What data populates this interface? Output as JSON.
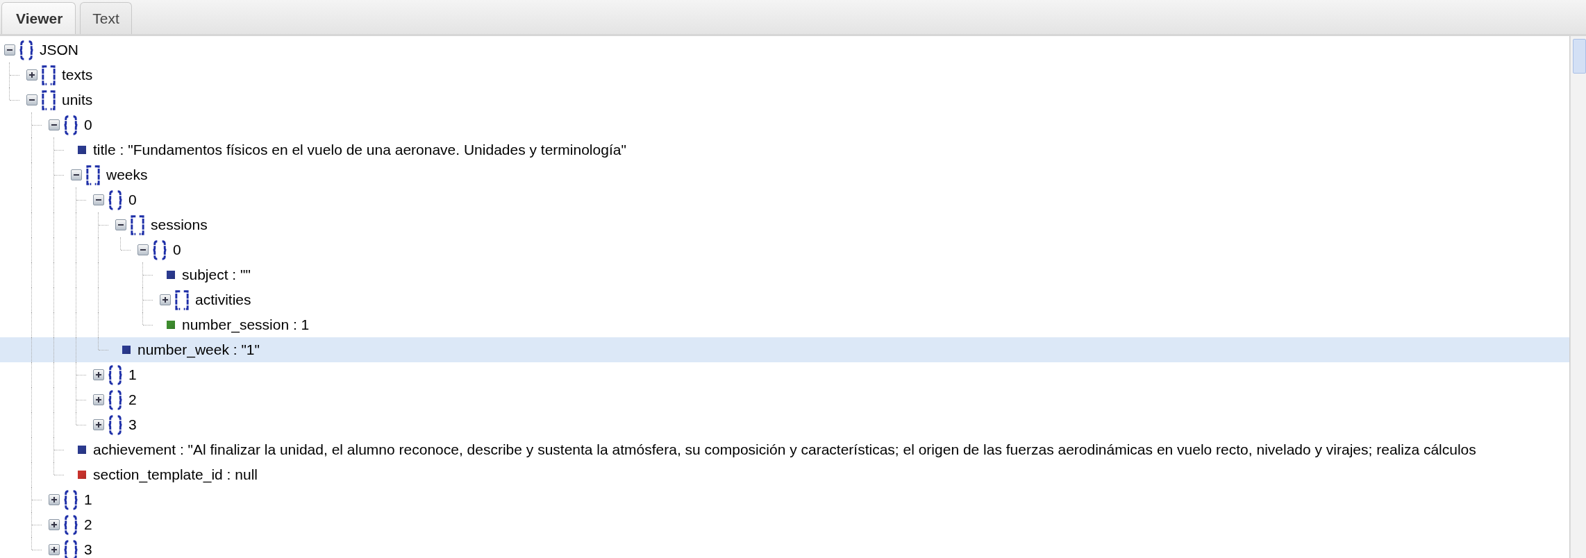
{
  "tabs": [
    {
      "label": "Viewer",
      "selected": true
    },
    {
      "label": "Text",
      "selected": false
    }
  ],
  "tree": {
    "kind": "object",
    "label": "JSON",
    "expanded": true,
    "selected": false,
    "children": [
      {
        "kind": "array",
        "label": "texts",
        "expanded": false,
        "selected": false
      },
      {
        "kind": "array",
        "label": "units",
        "expanded": true,
        "selected": false,
        "children": [
          {
            "kind": "object",
            "label": "0",
            "expanded": true,
            "selected": false,
            "children": [
              {
                "kind": "string",
                "label": "title : \"Fundamentos físicos en el vuelo de una aeronave. Unidades y terminología\"",
                "selected": false
              },
              {
                "kind": "array",
                "label": "weeks",
                "expanded": true,
                "selected": false,
                "children": [
                  {
                    "kind": "object",
                    "label": "0",
                    "expanded": true,
                    "selected": false,
                    "children": [
                      {
                        "kind": "array",
                        "label": "sessions",
                        "expanded": true,
                        "selected": false,
                        "children": [
                          {
                            "kind": "object",
                            "label": "0",
                            "expanded": true,
                            "selected": false,
                            "children": [
                              {
                                "kind": "string",
                                "label": "subject : \"\"",
                                "selected": false
                              },
                              {
                                "kind": "array",
                                "label": "activities",
                                "expanded": false,
                                "selected": false
                              },
                              {
                                "kind": "number",
                                "label": "number_session : 1",
                                "selected": false
                              }
                            ]
                          }
                        ]
                      },
                      {
                        "kind": "string",
                        "label": "number_week : \"1\"",
                        "selected": true
                      }
                    ]
                  },
                  {
                    "kind": "object",
                    "label": "1",
                    "expanded": false,
                    "selected": false
                  },
                  {
                    "kind": "object",
                    "label": "2",
                    "expanded": false,
                    "selected": false
                  },
                  {
                    "kind": "object",
                    "label": "3",
                    "expanded": false,
                    "selected": false
                  }
                ]
              },
              {
                "kind": "string",
                "label": "achievement : \"Al finalizar la unidad, el alumno reconoce, describe y sustenta la atmósfera, su composición y características; el origen de las fuerzas aerodinámicas en vuelo recto, nivelado y virajes; realiza cálculos",
                "selected": false
              },
              {
                "kind": "null",
                "label": "section_template_id : null",
                "selected": false
              }
            ]
          },
          {
            "kind": "object",
            "label": "1",
            "expanded": false,
            "selected": false
          },
          {
            "kind": "object",
            "label": "2",
            "expanded": false,
            "selected": false
          },
          {
            "kind": "object",
            "label": "3",
            "expanded": false,
            "selected": false
          }
        ]
      }
    ]
  }
}
